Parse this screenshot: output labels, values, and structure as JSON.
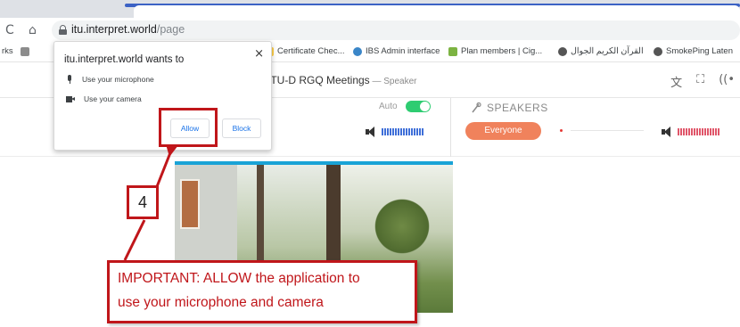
{
  "browser": {
    "url_host": "itu.interpret.world",
    "url_path": "/page",
    "back_glyph": "C",
    "home_glyph": "⌂",
    "bookmarks": [
      {
        "label": "rks",
        "color": "#8c8c8c"
      },
      {
        "label": "Certificate Chec...",
        "color": "#4b7bd3"
      },
      {
        "label": "IBS Admin interface",
        "color": "#3a86c8"
      },
      {
        "label": "Plan members | Cig...",
        "color": "#7cb342"
      },
      {
        "label": "القرآن الكريم الجوال",
        "color": "#555555"
      },
      {
        "label": "SmokePing Laten",
        "color": "#555555"
      }
    ]
  },
  "app": {
    "meeting_title": "ITU-D RGQ Meetings",
    "meeting_separator": " — ",
    "role": "Speaker",
    "header_icons": [
      "translate-icon",
      "fullscreen-icon",
      "broadcast-icon"
    ],
    "header_icon_glyphs": [
      "文",
      "⛶",
      "((•"
    ],
    "auto_label": "Auto",
    "auto_enabled": true,
    "speakers_title": "SPEAKERS",
    "everyone_label": "Everyone"
  },
  "permission_popup": {
    "title": "itu.interpret.world wants to",
    "close_glyph": "×",
    "items": [
      {
        "icon": "microphone-icon",
        "label": "Use your microphone"
      },
      {
        "icon": "camera-icon",
        "label": "Use your camera"
      }
    ],
    "allow_label": "Allow",
    "block_label": "Block"
  },
  "annotation": {
    "step_number": "4",
    "callout_line1": "IMPORTANT: ALLOW the application to",
    "callout_line2": "use your microphone and camera",
    "color": "#c0161a"
  }
}
